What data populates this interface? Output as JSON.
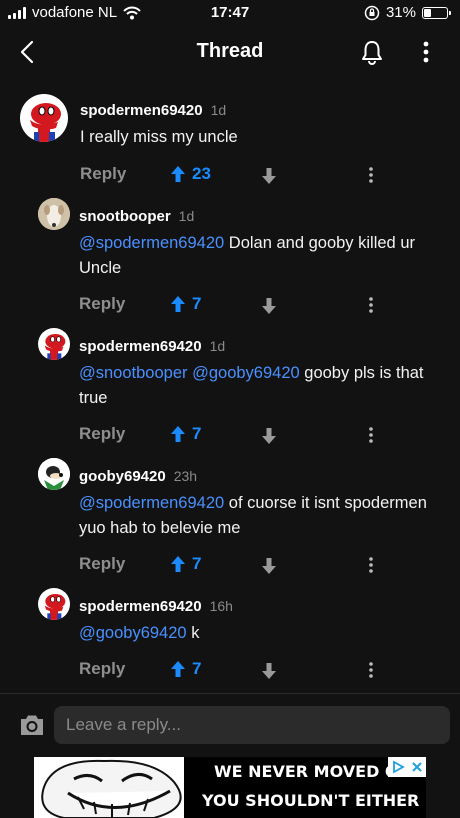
{
  "status": {
    "carrier": "vodafone NL",
    "time": "17:47",
    "battery": "31%",
    "battery_level": 0.31
  },
  "header": {
    "title": "Thread"
  },
  "comments": [
    {
      "username": "spodermen69420",
      "time": "1d",
      "text": "I really miss my uncle",
      "mentions": [],
      "reply_label": "Reply",
      "votes": "23",
      "avatar": "spiderman-avatar"
    },
    {
      "username": "snootbooper",
      "time": "1d",
      "text": "Dolan and gooby killed ur Uncle",
      "mentions": [
        "@spodermen69420"
      ],
      "reply_label": "Reply",
      "votes": "7",
      "avatar": "dog-avatar"
    },
    {
      "username": "spodermen69420",
      "time": "1d",
      "text": "gooby pls is that true",
      "mentions": [
        "@snootbooper",
        "@gooby69420"
      ],
      "reply_label": "Reply",
      "votes": "7",
      "avatar": "spiderman-avatar"
    },
    {
      "username": "gooby69420",
      "time": "23h",
      "text": "of cuorse it isnt spodermen yuo hab to belevie me",
      "mentions": [
        "@spodermen69420"
      ],
      "reply_label": "Reply",
      "votes": "7",
      "avatar": "goofy-avatar"
    },
    {
      "username": "spodermen69420",
      "time": "16h",
      "text": "k",
      "mentions": [
        "@gooby69420"
      ],
      "reply_label": "Reply",
      "votes": "7",
      "avatar": "spiderman-avatar"
    }
  ],
  "compose": {
    "placeholder": "Leave a reply..."
  },
  "ad": {
    "line1": "WE NEVER MOVED O",
    "line2": "YOU SHOULDN'T EITHER"
  },
  "colors": {
    "background": "#121212",
    "mention": "#4a90ff",
    "upvote": "#1a8cff",
    "muted": "#8e8e8e"
  }
}
